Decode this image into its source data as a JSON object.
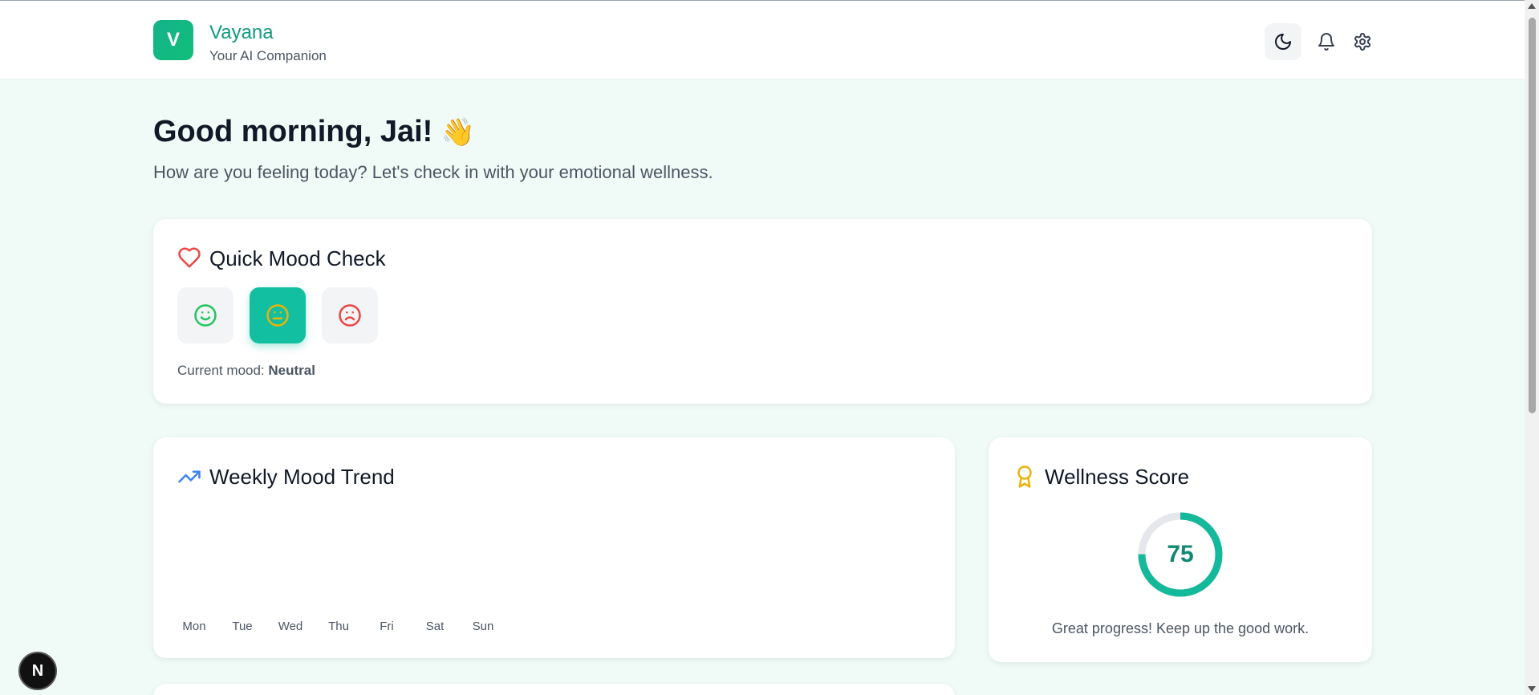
{
  "header": {
    "logo_letter": "V",
    "brand_name": "Vayana",
    "tagline": "Your AI Companion",
    "icons": [
      "moon-icon",
      "bell-icon",
      "gear-icon"
    ]
  },
  "greeting": {
    "title": "Good morning, Jai!",
    "emoji": "👋",
    "subtitle": "How are you feeling today? Let's check in with your emotional wellness."
  },
  "mood_check": {
    "title": "Quick Mood Check",
    "options": [
      {
        "name": "happy",
        "icon": "smile-icon",
        "selected": false,
        "color": "#22c55e"
      },
      {
        "name": "neutral",
        "icon": "meh-icon",
        "selected": true,
        "color": "#eab308"
      },
      {
        "name": "sad",
        "icon": "frown-icon",
        "selected": false,
        "color": "#ef4444"
      }
    ],
    "current_label": "Current mood:",
    "current_value": "Neutral"
  },
  "weekly_trend": {
    "title": "Weekly Mood Trend",
    "days": [
      "Mon",
      "Tue",
      "Wed",
      "Thu",
      "Fri",
      "Sat",
      "Sun"
    ]
  },
  "wellness": {
    "title": "Wellness Score",
    "score": "75",
    "score_fraction": 0.75,
    "message": "Great progress! Keep up the good work."
  },
  "dev_badge": {
    "letter": "N"
  },
  "colors": {
    "brand": "#0f9b80",
    "accent": "#13bfa1",
    "ring": "#14b89a",
    "heart": "#ef4444",
    "trend": "#3b82f6",
    "award": "#eab308"
  }
}
